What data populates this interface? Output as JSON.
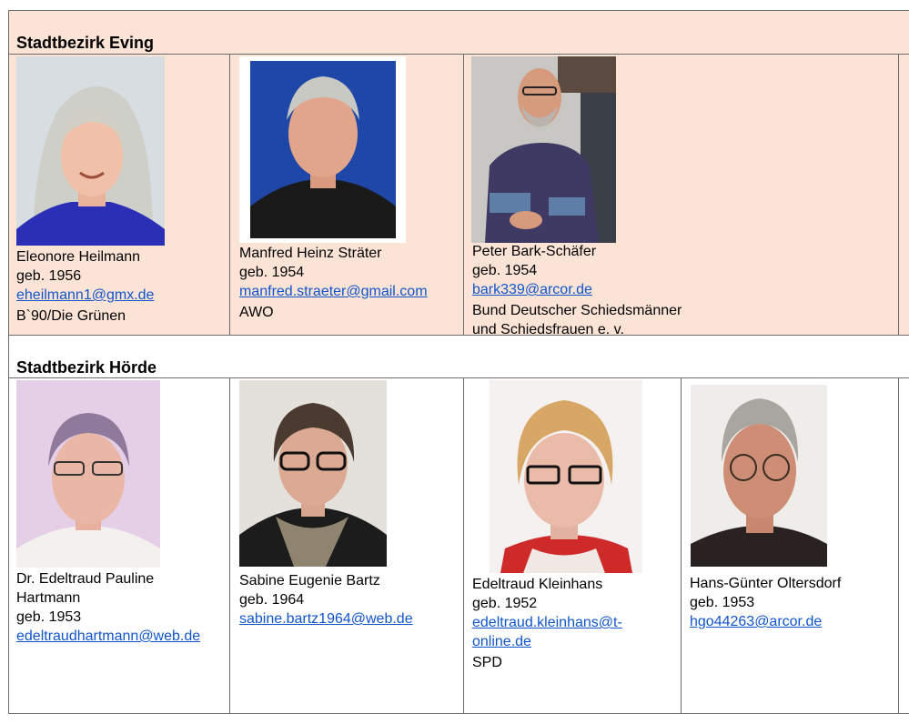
{
  "colors": {
    "eving_bg": "#fbe3d6",
    "hoerde_bg": "#ffffff",
    "link": "#1155cc",
    "border": "#6b6b6b"
  },
  "sections": [
    {
      "heading": "Stadtbezirk Eving",
      "people": [
        {
          "name": "Eleonore Heilmann",
          "born": "geb. 1956",
          "email": "eheilmann1@gmx.de",
          "org": "B`90/Die Grünen"
        },
        {
          "name": "Manfred Heinz Sträter",
          "born": "geb. 1954",
          "email": "manfred.straeter@gmail.com",
          "org": "AWO"
        },
        {
          "name": "Peter Bark-Schäfer",
          "born": "geb. 1954",
          "email": "bark339@arcor.de",
          "org_line1": "Bund Deutscher Schiedsmänner",
          "org_line2": "und Schiedsfrauen e. v."
        }
      ]
    },
    {
      "heading": "Stadtbezirk Hörde",
      "people": [
        {
          "name_line1": "Dr. Edeltraud Pauline",
          "name_line2": "Hartmann",
          "born": "geb. 1953",
          "email": "edeltraudhartmann@web.de"
        },
        {
          "name": "Sabine Eugenie Bartz",
          "born": "geb. 1964",
          "email": "sabine.bartz1964@web.de"
        },
        {
          "name": "Edeltraud Kleinhans",
          "born": "geb. 1952",
          "email_line1": "edeltraud.kleinhans@t-",
          "email_line2": "online.de",
          "org": "SPD"
        },
        {
          "name": "Hans-Günter Oltersdorf",
          "born": "geb. 1953",
          "email": "hgo44263@arcor.de"
        }
      ]
    }
  ]
}
